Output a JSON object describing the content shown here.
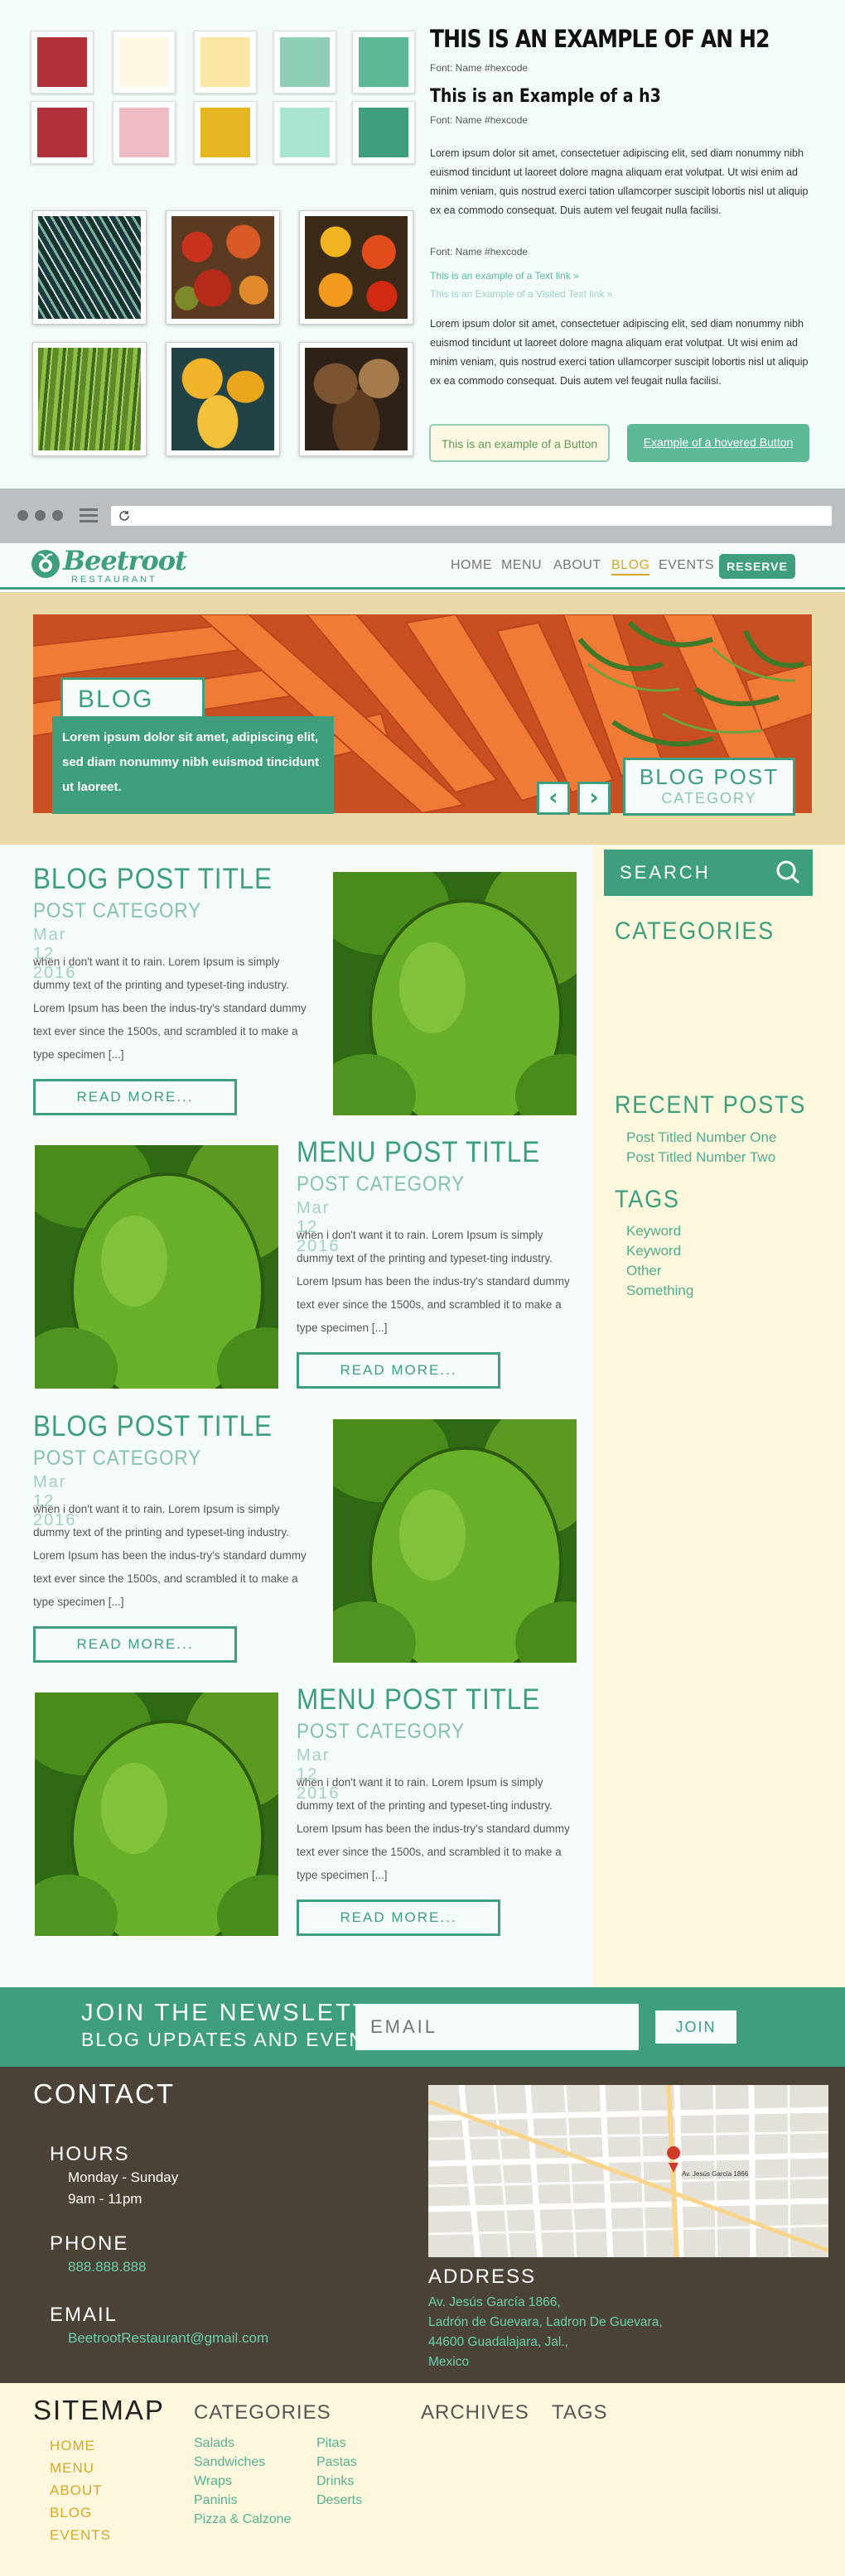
{
  "style_guide": {
    "swatches": [
      "#b0313a",
      "#fef8e4",
      "#fbe6a8",
      "#8fcfb5",
      "#5db896",
      "#b0313a",
      "#efbcc3",
      "#e6b523",
      "#a8e6d0",
      "#3e9e7e"
    ],
    "h2": "THIS IS AN EXAMPLE OF AN H2",
    "h2_note": "Font: Name #hexcode",
    "h3": "This is an Example of a h3",
    "h3_note": "Font: Name #hexcode",
    "paragraph": "Lorem ipsum dolor sit amet, consectetuer adipiscing elit, sed diam nonummy nibh euismod tincidunt ut laoreet dolore magna aliquam erat volutpat. Ut wisi enim ad minim veniam, quis nostrud exerci tation ullamcorper suscipit lobortis nisl ut aliquip ex ea commodo consequat. Duis autem vel feugait nulla facilisi.",
    "paragraph_note": "Font: Name #hexcode",
    "text_link": "This is an example of a Text link »",
    "visited_link": "This is an Example of a Visited Text link »",
    "paragraph2": "Lorem ipsum dolor sit amet, consectetuer adipiscing elit, sed diam nonummy nibh euismod tincidunt ut laoreet dolore magna aliquam erat volutpat. Ut wisi enim ad minim veniam, quis nostrud exerci tation ullamcorper suscipit lobortis nisl ut aliquip ex ea commodo consequat. Duis autem vel feugait nulla facilisi.",
    "button": "This is an example of a Button",
    "button_hover": "Example of a hovered Button"
  },
  "header": {
    "logo_name": "Beetroot",
    "logo_sub": "RESTAURANT",
    "nav": [
      "HOME",
      "MENU",
      "ABOUT",
      "BLOG",
      "EVENTS"
    ],
    "reserve": "RESERVE"
  },
  "hero": {
    "tag": "BLOG",
    "text": "Lorem ipsum dolor sit amet, adipiscing elit, sed diam nonummy nibh euismod tincidunt ut laoreet.",
    "prev": "‹",
    "next": "›",
    "post_title": "BLOG POST",
    "post_category": "CATEGORY"
  },
  "posts": [
    {
      "title": "BLOG POST TITLE",
      "category": "POST CATEGORY",
      "date": "Mar 12 2016",
      "excerpt": "when i don't want it to rain. Lorem Ipsum is simply dummy text of the printing and typeset-ting industry. Lorem Ipsum has been the indus-try's standard dummy text ever since the 1500s, and scrambled it to make a type specimen [...]",
      "read_more": "READ MORE..."
    },
    {
      "title": "MENU POST TITLE",
      "category": "POST CATEGORY",
      "date": "Mar 12 2016",
      "excerpt": "when i don't want it to rain. Lorem Ipsum is simply dummy text of the printing and typeset-ting industry. Lorem Ipsum has been the indus-try's standard dummy text ever since the 1500s, and scrambled it to make a type specimen [...]",
      "read_more": "READ MORE..."
    },
    {
      "title": "BLOG POST TITLE",
      "category": "POST CATEGORY",
      "date": "Mar 12 2016",
      "excerpt": "when i don't want it to rain. Lorem Ipsum is simply dummy text of the printing and typeset-ting industry. Lorem Ipsum has been the indus-try's standard dummy text ever since the 1500s, and scrambled it to make a type specimen [...]",
      "read_more": "READ MORE..."
    },
    {
      "title": "MENU POST TITLE",
      "category": "POST CATEGORY",
      "date": "Mar 12 2016",
      "excerpt": "when i don't want it to rain. Lorem Ipsum is simply dummy text of the printing and typeset-ting industry. Lorem Ipsum has been the indus-try's standard dummy text ever since the 1500s, and scrambled it to make a type specimen [...]",
      "read_more": "READ MORE..."
    }
  ],
  "sidebar": {
    "search_placeholder": "SEARCH",
    "categories_heading": "CATEGORIES",
    "recent_heading": "RECENT POSTS",
    "recent": [
      "Post Titled Number One",
      "Post Titled Number Two"
    ],
    "tags_heading": "TAGS",
    "tags": [
      "Keyword",
      "Keyword",
      "Other",
      "Something"
    ]
  },
  "newsletter": {
    "heading": "JOIN THE NEWSLETTER",
    "subheading": "BLOG UPDATES AND EVENTS",
    "email_placeholder": "EMAIL",
    "join": "JOIN"
  },
  "contact": {
    "heading": "CONTACT",
    "hours_label": "HOURS",
    "hours_days": "Monday - Sunday",
    "hours_time": "9am - 11pm",
    "phone_label": "PHONE",
    "phone": "888.888.888",
    "email_label": "EMAIL",
    "email": "BeetrootRestaurant@gmail.com",
    "address_label": "ADDRESS",
    "address": [
      "Av. Jesús García 1866,",
      "Ladrón de Guevara, Ladron De Guevara,",
      "44600 Guadalajara, Jal.,",
      "Mexico"
    ],
    "map_marker_label": "Av. Jesús García 1866"
  },
  "sitemap": {
    "heading": "SITEMAP",
    "links": [
      "HOME",
      "MENU",
      "ABOUT",
      "BLOG",
      "EVENTS"
    ],
    "categories_heading": "CATEGORIES",
    "categories_col1": [
      "Salads",
      "Sandwiches",
      "Wraps",
      "Paninis",
      "Pizza & Calzone"
    ],
    "categories_col2": [
      "Pitas",
      "Pastas",
      "Drinks",
      "Deserts"
    ],
    "archives_heading": "ARCHIVES",
    "tags_heading": "TAGS"
  }
}
